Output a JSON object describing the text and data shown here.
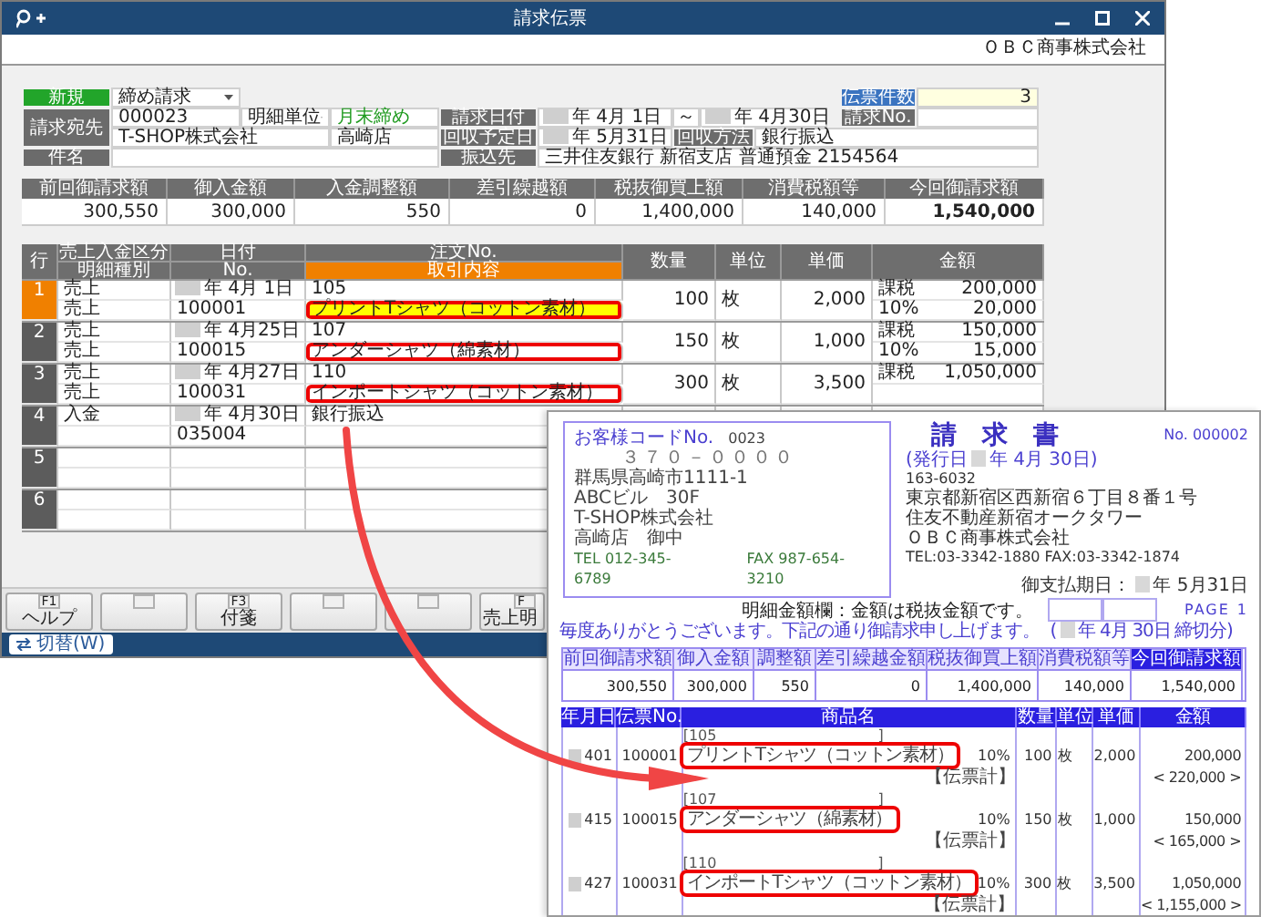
{
  "window": {
    "title": "請求伝票",
    "company": "ＯＢＣ商事株式会社"
  },
  "form": {
    "mode": "新規",
    "billing_type": "締め請求",
    "slip_count_label": "伝票件数",
    "slip_count": "3",
    "customer_label": "請求宛先",
    "customer_code": "000023",
    "detail_unit": "明細単位",
    "closing": "月末締め",
    "customer_name": "T-SHOP株式会社",
    "branch": "高崎店",
    "subject_label": "件名",
    "billing_date_label": "請求日付",
    "billing_date_from": "年 4月 1日",
    "range_sign": "～",
    "billing_date_to": "年 4月30日",
    "invoice_no_label": "請求No.",
    "collection_date_label": "回収予定日",
    "collection_date": "年 5月31日",
    "collection_method_label": "回収方法",
    "collection_method": "銀行振込",
    "transfer_label": "振込先",
    "transfer_account": "三井住友銀行 新宿支店 普通預金 2154564"
  },
  "summary": {
    "columns": [
      "前回御請求額",
      "御入金額",
      "入金調整額",
      "差引繰越額",
      "税抜御買上額",
      "消費税額等",
      "今回御請求額"
    ],
    "values": [
      "300,550",
      "300,000",
      "550",
      "0",
      "1,400,000",
      "140,000",
      "1,540,000"
    ]
  },
  "detail_table": {
    "columns": [
      "行",
      "売上入金区分",
      "明細種別",
      "日付",
      "No.",
      "注文No.",
      "取引内容",
      "数量",
      "単位",
      "単価",
      "金額"
    ],
    "rows": [
      {
        "number": "1",
        "category": "売上",
        "line_type": "売上",
        "date": "年 4月 1日",
        "slip_no": "100001",
        "order_no": "105",
        "content": "プリントTシャツ（コットン素材）",
        "quantity": "100",
        "unit": "枚",
        "unit_price": "2,000",
        "tax_type": "課税",
        "amount": "200,000",
        "tax_rate": "10%",
        "tax_amount": "20,000",
        "selected": true,
        "highlighted": true
      },
      {
        "number": "2",
        "category": "売上",
        "line_type": "売上",
        "date": "年 4月25日",
        "slip_no": "100015",
        "order_no": "107",
        "content": "アンダーシャツ（綿素材）",
        "quantity": "150",
        "unit": "枚",
        "unit_price": "1,000",
        "tax_type": "課税",
        "amount": "150,000",
        "tax_rate": "10%",
        "tax_amount": "15,000",
        "selected": false,
        "highlighted": true
      },
      {
        "number": "3",
        "category": "売上",
        "line_type": "売上",
        "date": "年 4月27日",
        "slip_no": "100031",
        "order_no": "110",
        "content": "インポートシャツ（コットン素材）",
        "quantity": "300",
        "unit": "枚",
        "unit_price": "3,500",
        "tax_type": "課税",
        "amount": "1,050,000",
        "selected": false,
        "highlighted": true
      },
      {
        "number": "4",
        "category": "入金",
        "date": "年 4月30日",
        "slip_no": "035004",
        "order_no": "銀行振込",
        "selected": false,
        "highlighted": false
      },
      {
        "number": "5",
        "selected": false,
        "highlighted": false
      },
      {
        "number": "6",
        "selected": false,
        "highlighted": false
      }
    ]
  },
  "function_keys": [
    {
      "kind": "key",
      "key": "F1",
      "label": "ヘルプ"
    },
    {
      "kind": "blank"
    },
    {
      "kind": "key",
      "key": "F3",
      "label": "付箋"
    },
    {
      "kind": "blank"
    },
    {
      "kind": "blank"
    },
    {
      "kind": "key",
      "key": "F",
      "label": "売上明"
    }
  ],
  "status_bar": {
    "switch_button": "切替(W)"
  },
  "invoice_document": {
    "customer_code_label": "お客様コードNo.",
    "customer_code": "0023",
    "postal_code": "３７０－００００",
    "address_lines": [
      "群馬県高崎市1111-1",
      "ABCビル　30F"
    ],
    "recipient_lines": [
      "T-SHOP株式会社",
      "高崎店　御中"
    ],
    "tel": "TEL 012-345-6789",
    "fax": "FAX 987-654-3210",
    "title": "請　求　書",
    "number": "No. 000002",
    "issue_label": "(発行日",
    "issue_date": "年 4月 30日)",
    "sender_postal": "163-6032",
    "sender_lines": [
      "東京都新宿区西新宿６丁目８番１号",
      "住友不動産新宿オークタワー",
      "ＯＢＣ商事株式会社"
    ],
    "sender_contact": "TEL:03-3342-1880 FAX:03-3342-1874",
    "due_label": "御支払期日：",
    "due_date": "年 5月31日",
    "note": "明細金額欄：金額は税抜金額です。",
    "page_label": "PAGE",
    "page": "1",
    "greeting": "毎度ありがとうございます。下記の通り御請求申し上げます。",
    "period_open": "(",
    "period": "年 4月 30日 締切分)",
    "summary": {
      "columns": [
        "前回御請求額",
        "御入金額",
        "調整額",
        "差引繰越金額",
        "税抜御買上額",
        "消費税額等",
        "今回御請求額"
      ],
      "values": [
        "300,550",
        "300,000",
        "550",
        "0",
        "1,400,000",
        "140,000",
        "1,540,000"
      ]
    },
    "columns": [
      "年月日",
      "伝票No.",
      "商品名",
      "数量",
      "単位",
      "単価",
      "金額"
    ],
    "rows": [
      {
        "date": "401",
        "slip_no": "100001",
        "order_no": "[105",
        "order_close": "]",
        "product": "プリントTシャツ（コットン素材）",
        "tax_rate": "10%",
        "quantity": "100",
        "unit": "枚",
        "unit_price": "2,000",
        "amount": "200,000",
        "total_label": "【伝票計】",
        "total": "< 220,000 >",
        "highlighted": true
      },
      {
        "date": "415",
        "slip_no": "100015",
        "order_no": "[107",
        "order_close": "]",
        "product": "アンダーシャツ（綿素材）",
        "tax_rate": "10%",
        "quantity": "150",
        "unit": "枚",
        "unit_price": "1,000",
        "amount": "150,000",
        "total_label": "【伝票計】",
        "total": "< 165,000 >",
        "highlighted": true
      },
      {
        "date": "427",
        "slip_no": "100031",
        "order_no": "[110",
        "order_close": "]",
        "product": "インポートTシャツ（コットン素材）",
        "tax_rate": "10%",
        "quantity": "300",
        "unit": "枚",
        "unit_price": "3,500",
        "amount": "1,050,000",
        "total_label": "【伝票計】",
        "total": "< 1,155,000 >",
        "highlighted": true
      }
    ]
  }
}
